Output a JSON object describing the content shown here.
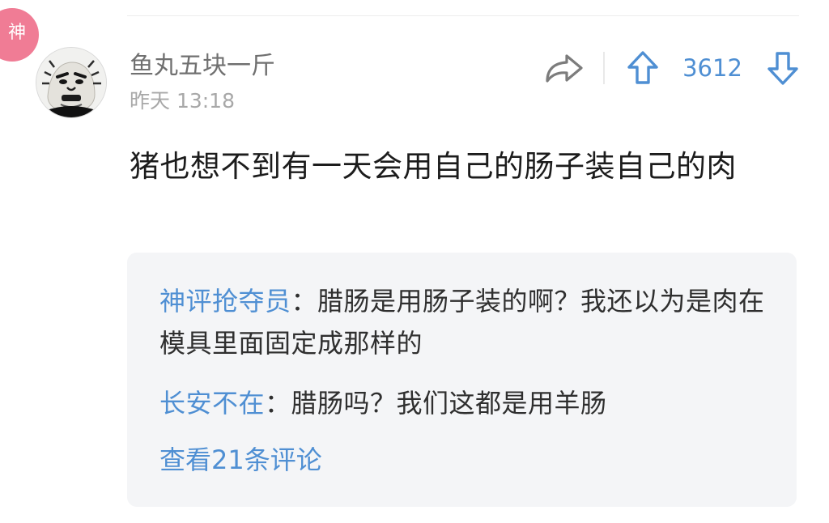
{
  "badge": {
    "label": "神"
  },
  "comment": {
    "username": "鱼丸五块一斤",
    "timestamp": "昨天 13:18",
    "content": "猪也想不到有一天会用自己的肠子装自己的肉",
    "vote_count": "3612"
  },
  "icons": {
    "share": "share-icon",
    "upvote": "arrow-up-icon",
    "downvote": "arrow-down-icon",
    "avatar": "avatar-face-image"
  },
  "replies": [
    {
      "author": "神评抢夺员",
      "separator": "：",
      "text": "腊肠是用肠子装的啊？我还以为是肉在模具里面固定成那样的"
    },
    {
      "author": "长安不在",
      "separator": "：",
      "text": "腊肠吗？我们这都是用羊肠"
    }
  ],
  "view_more": "查看21条评论",
  "colors": {
    "accent": "#4f8fd3",
    "badge": "#f07c95",
    "username": "#707070",
    "timestamp": "#a8a8a8",
    "reply_background": "#f4f5f7"
  }
}
